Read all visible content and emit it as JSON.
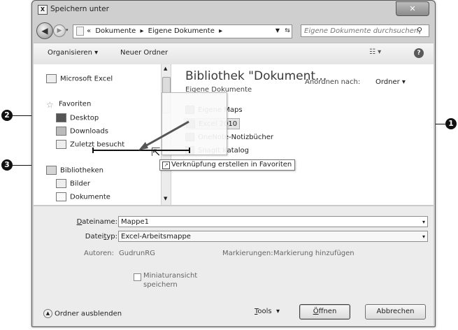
{
  "window": {
    "title": "Speichern unter",
    "close_glyph": "✕"
  },
  "address": {
    "overflow": "«",
    "crumbs": [
      "Dokumente",
      "Eigene Dokumente"
    ],
    "separator": "▸",
    "search_placeholder": "Eigene Dokumente durchsuchen"
  },
  "toolbar": {
    "organize_label": "Organisieren ▾",
    "new_folder_label": "Neuer Ordner",
    "view_label": "☷ ▾",
    "help_label": "?"
  },
  "navpane": {
    "items": [
      {
        "label": "Microsoft Excel",
        "icon": "excel-icon"
      },
      {
        "label": "Favoriten",
        "icon": "star-icon"
      },
      {
        "label": "Desktop",
        "icon": "desktop-icon"
      },
      {
        "label": "Downloads",
        "icon": "downloads-icon"
      },
      {
        "label": "Zuletzt besucht",
        "icon": "recent-places-icon"
      },
      {
        "label": "Bibliotheken",
        "icon": "libraries-icon"
      },
      {
        "label": "Bilder",
        "icon": "pictures-icon"
      },
      {
        "label": "Dokumente",
        "icon": "documents-icon"
      }
    ],
    "drag_tooltip": "Verknüpfung erstellen in Favoriten"
  },
  "content": {
    "library_title": "Bibliothek \"Dokument...",
    "library_subtitle": "Eigene Dokumente",
    "sort_label": "Anordnen nach:",
    "sort_value": "Ordner ▾",
    "files": [
      "Eigene Maps",
      "Excel 2010",
      "OneNote-Notizbücher",
      "SnagIt Katalog"
    ]
  },
  "form": {
    "filename_label_pre": "D",
    "filename_label_rest": "ateiname:",
    "filename_value": "Mappe1",
    "filetype_label_pre": "Datei",
    "filetype_label_u": "t",
    "filetype_label_post": "yp:",
    "filetype_value": "Excel-Arbeitsmappe",
    "authors_label": "Autoren:",
    "authors_value": "GudrunRG",
    "tags_label": "Markierungen:",
    "tags_value": "Markierung hinzufügen",
    "thumbnail_label_1": "Miniaturansicht",
    "thumbnail_label_2": "speichern",
    "hide_folders": "Ordner ausblenden",
    "tools_u": "T",
    "tools_rest": "ools",
    "open_u": "Ö",
    "open_rest": "ffnen",
    "cancel": "Abbrechen"
  },
  "callouts": {
    "one": "1",
    "two": "2",
    "three": "3"
  }
}
